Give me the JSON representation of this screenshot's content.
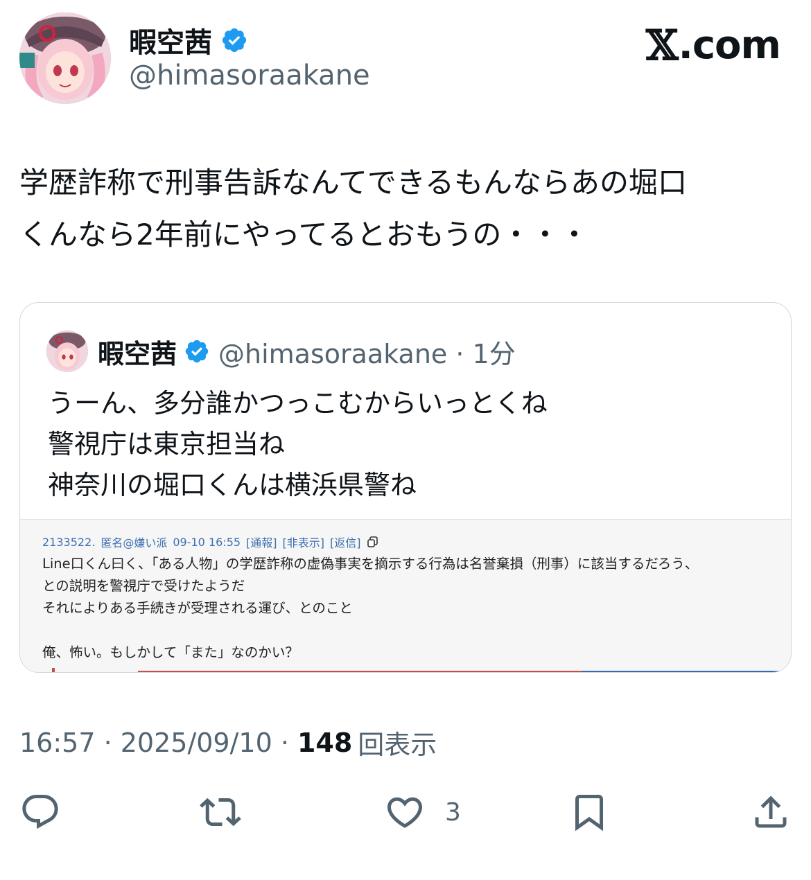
{
  "header": {
    "display_name": "暇空茜",
    "handle": "@himasoraakane",
    "brand": {
      "x": "𝕏",
      "domain": ".com"
    },
    "verified_color": "#1d9bf0"
  },
  "tweet": {
    "text": "学歴詐称で刑事告訴なんてできるもんならあの堀口\nくんなら2年前にやってるとおもうの・・・"
  },
  "quote": {
    "display_name": "暇空茜",
    "handle_time": "@himasoraakane · 1分",
    "text": "うーん、多分誰かつっこむからいっとくね\n警視庁は東京担当ね\n神奈川の堀口くんは横浜県警ね",
    "image": {
      "post_id": "2133522.",
      "poster": "匿名@嫌い派",
      "datetime": "09-10 16:55",
      "report": "[通報]",
      "hide": "[非表示]",
      "reply": "[返信]",
      "body": "Line口くん曰く、「ある人物」の学歴詐称の虚偽事実を摘示する行為は名誉棄損（刑事）に該当するだろう、\nとの説明を警視庁で受けたようだ\nそれによりある手続きが受理される運び、とのこと\n\n俺、怖い。もしかして「また」なのかい？"
    }
  },
  "meta": {
    "time_date": "16:57 · 2025/09/10 ·",
    "views_count": "148",
    "views_label": "回表示"
  },
  "actions": {
    "reply_icon": "reply-icon",
    "repost_icon": "repost-icon",
    "like_icon": "heart-icon",
    "like_count": "3",
    "bookmark_icon": "bookmark-icon",
    "share_icon": "share-icon",
    "icon_color": "#536471"
  }
}
